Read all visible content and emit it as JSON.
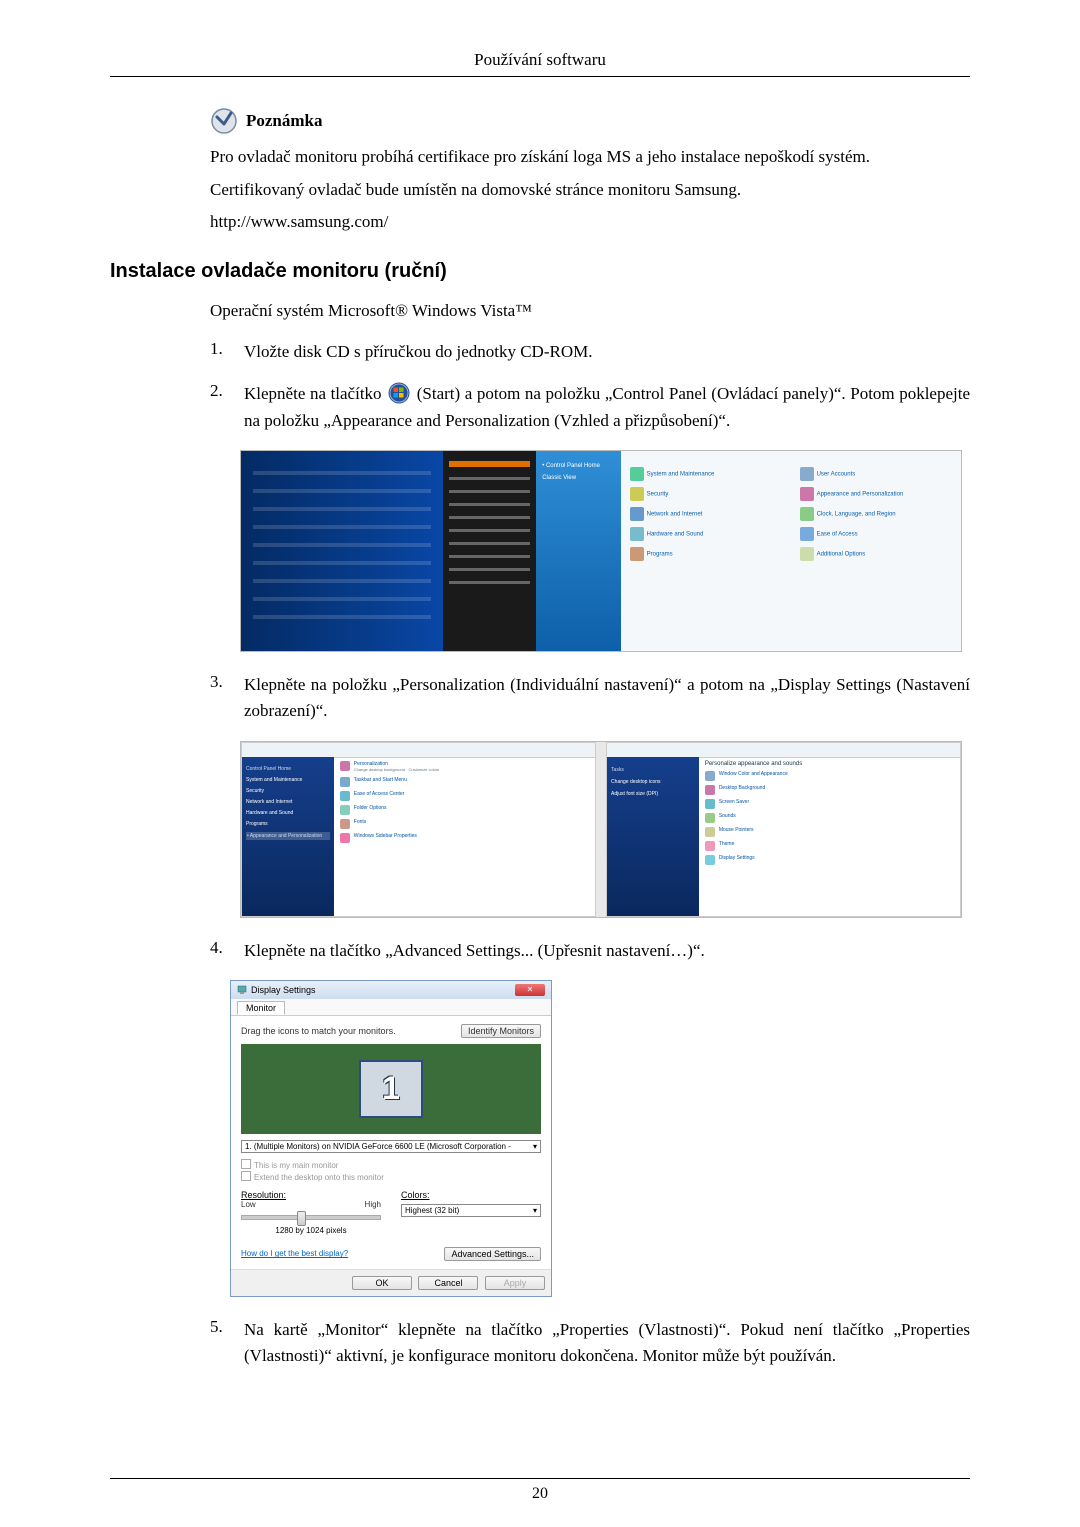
{
  "header_title": "Používání softwaru",
  "note": {
    "title": "Poznámka",
    "p1": "Pro ovladač monitoru probíhá certifikace pro získání loga MS a jeho instalace nepoškodí systém.",
    "p2": "Certifikovaný ovladač bude umístěn na domovské stránce monitoru Samsung.",
    "p3": "http://www.samsung.com/"
  },
  "h2": "Instalace ovladače monitoru (ruční)",
  "os_line": "Operační systém Microsoft® Windows Vista™",
  "steps": {
    "n1": "1.",
    "t1": "Vložte disk CD s příručkou do jednotky CD-ROM.",
    "n2": "2.",
    "t2a": "Klepněte na tlačítko ",
    "t2b": "(Start) a potom na položku „Control Panel (Ovládací panely)“. Potom poklepejte na položku „Appearance and Personalization (Vzhled a přizpůsobení)“.",
    "n3": "3.",
    "t3": "Klepněte na položku „Personalization (Individuální nastavení)“ a potom na „Display Settings (Nastavení zobrazení)“.",
    "n4": "4.",
    "t4": "Klepněte na tlačítko „Advanced Settings... (Upřesnit nastavení…)“.",
    "n5": "5.",
    "t5": "Na kartě „Monitor“ klepněte na tlačítko „Properties (Vlastnosti)“. Pokud není tlačítko „Properties (Vlastnosti)“ aktivní, je konfigurace monitoru dokončena. Monitor může být používán."
  },
  "display_settings": {
    "title": "Display Settings",
    "tab": "Monitor",
    "drag_text": "Drag the icons to match your monitors.",
    "identify_btn": "Identify Monitors",
    "monitor_num": "1",
    "dropdown": "1. (Multiple Monitors) on NVIDIA GeForce 6600 LE (Microsoft Corporation - ",
    "check1": "This is my main monitor",
    "check2": "Extend the desktop onto this monitor",
    "res_label": "Resolution:",
    "res_low": "Low",
    "res_high": "High",
    "res_value": "1280 by 1024 pixels",
    "colors_label": "Colors:",
    "colors_value": "Highest (32 bit)",
    "help_link": "How do I get the best display?",
    "advanced_btn": "Advanced Settings...",
    "ok": "OK",
    "cancel": "Cancel",
    "apply": "Apply"
  },
  "page_number": "20"
}
